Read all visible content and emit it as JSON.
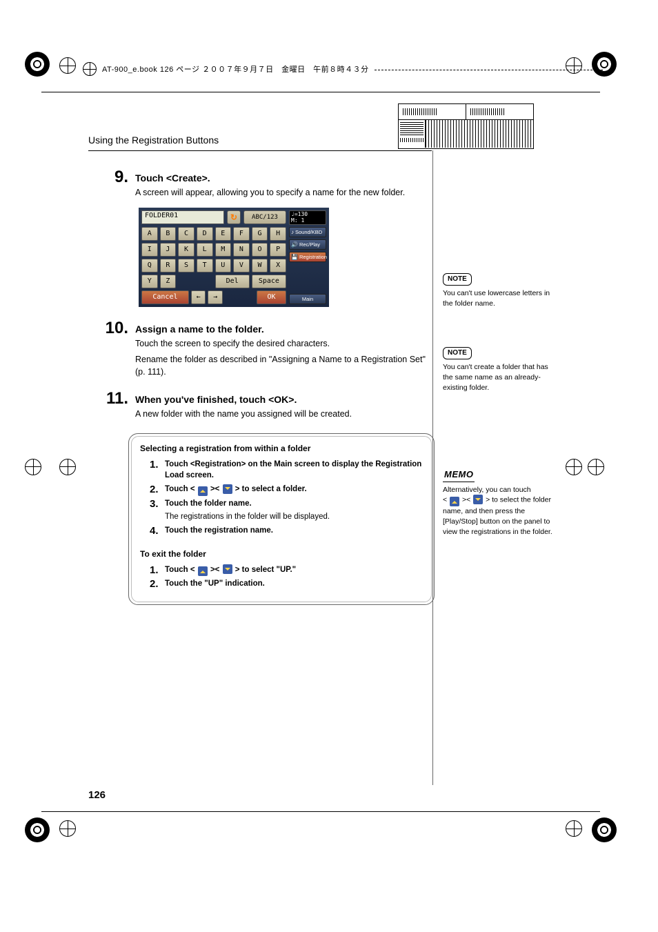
{
  "header": {
    "file_info": "AT-900_e.book  126 ページ  ２００７年９月７日　金曜日　午前８時４３分"
  },
  "section_title": "Using the Registration Buttons",
  "page_number": "126",
  "steps": {
    "s9": {
      "num": "9.",
      "title": "Touch <Create>.",
      "text": "A screen will appear, allowing you to specify a name for the new folder."
    },
    "s10": {
      "num": "10.",
      "title": "Assign a name to the folder.",
      "line1": "Touch the screen to specify the desired characters.",
      "line2": "Rename the folder as described in \"Assigning a Name to a Registration Set\" (p. 111)."
    },
    "s11": {
      "num": "11.",
      "title": "When you've finished, touch <OK>.",
      "text": "A new folder with the name you assigned will be created."
    }
  },
  "ui": {
    "foldername": "FOLDER01",
    "mode": "ABC/123",
    "keys_r1": [
      "A",
      "B",
      "C",
      "D",
      "E",
      "F",
      "G",
      "H"
    ],
    "keys_r2": [
      "I",
      "J",
      "K",
      "L",
      "M",
      "N",
      "O",
      "P"
    ],
    "keys_r3": [
      "Q",
      "R",
      "S",
      "T",
      "U",
      "V",
      "W",
      "X"
    ],
    "r4_y": "Y",
    "r4_z": "Z",
    "del": "Del",
    "space": "Space",
    "cancel": "Cancel",
    "ok": "OK",
    "arrow_l": "←",
    "arrow_r": "→",
    "tempo_top": "♩=130",
    "tempo_bot": "M:   1",
    "side_sound": "Sound/KBD",
    "side_rec": "Rec/Play",
    "side_reg": "Registration",
    "side_main": "Main"
  },
  "panel": {
    "h1": "Selecting a registration from within a folder",
    "p1": {
      "n": "1.",
      "t": "Touch <Registration> on the Main screen to display the Registration Load screen."
    },
    "p2": {
      "n": "2.",
      "t_a": "Touch < ",
      "t_b": " >< ",
      "t_c": " > to select a folder."
    },
    "p3": {
      "n": "3.",
      "t": "Touch the folder name.",
      "sub": "The registrations in the folder will be displayed."
    },
    "p4": {
      "n": "4.",
      "t": "Touch the registration name."
    },
    "h2": "To exit the folder",
    "e1": {
      "n": "1.",
      "t_a": "Touch < ",
      "t_b": " >< ",
      "t_c": " > to select \"UP.\""
    },
    "e2": {
      "n": "2.",
      "t": "Touch the \"UP\" indication."
    }
  },
  "notes": {
    "note_label": "NOTE",
    "note1": "You can't use lowercase letters in the folder name.",
    "note2": "You can't create a folder that has the same name as an already-existing folder.",
    "memo_label": "MEMO",
    "memo_a": "Alternatively, you can touch",
    "memo_b1": "< ",
    "memo_b2": " >< ",
    "memo_b3": " > to select the",
    "memo_c": "folder name, and then press the [Play/Stop] button on the panel to view the registrations in the folder."
  }
}
